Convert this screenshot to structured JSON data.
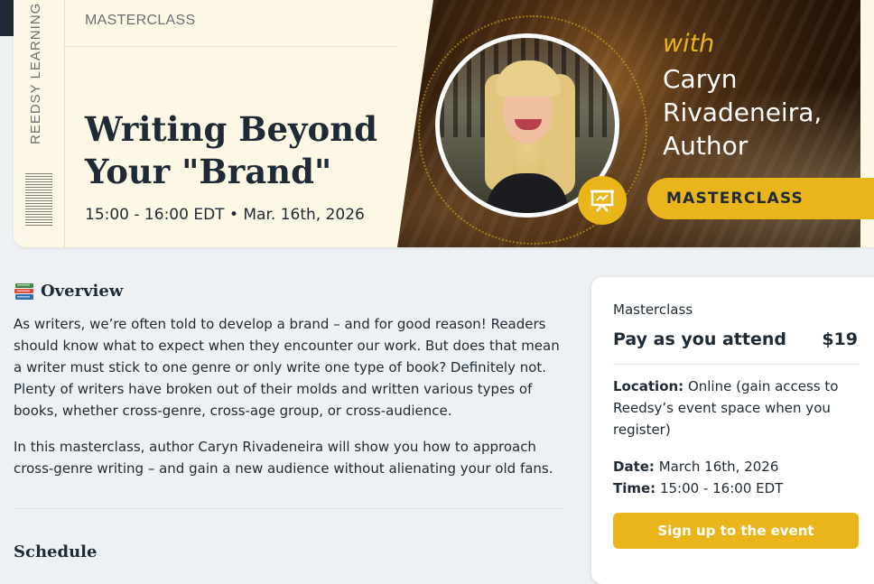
{
  "banner": {
    "stub_label": "REEDSY LEARNING",
    "eyebrow": "MASTERCLASS",
    "title_line1": "Writing Beyond",
    "title_line2": "Your \"Brand\"",
    "time": "15:00 - 16:00 EDT • Mar. 16th, 2026",
    "with": "with",
    "presenter_line1": "Caryn",
    "presenter_line2": "Rivadeneira,",
    "presenter_line3": "Author",
    "pill": "MASTERCLASS",
    "accent": "#eab51a"
  },
  "overview": {
    "icon": "books-icon",
    "heading": "Overview",
    "paragraph1": "As writers, we’re often told to develop a brand – and for good reason! Readers should know what to expect when they encounter our work. But does that mean a writer must stick to one genre or only write one type of book? Definitely not. Plenty of writers have broken out of their molds and written various types of books, whether cross-genre, cross-age group, or cross-audience.",
    "paragraph2": "In this masterclass, author Caryn Rivadeneira will show you how to approach cross-genre writing – and gain a new audience without alienating your old fans.",
    "schedule_heading": "Schedule"
  },
  "card": {
    "label": "Masterclass",
    "pay_label": "Pay as you attend",
    "price": "$19",
    "location_label": "Location:",
    "location_value": " Online (gain access to Reedsy’s event space when you register)",
    "date_label": "Date:",
    "date_value": " March 16th, 2026",
    "time_label": "Time:",
    "time_value": " 15:00 - 16:00 EDT",
    "signup": "Sign up to the event"
  }
}
